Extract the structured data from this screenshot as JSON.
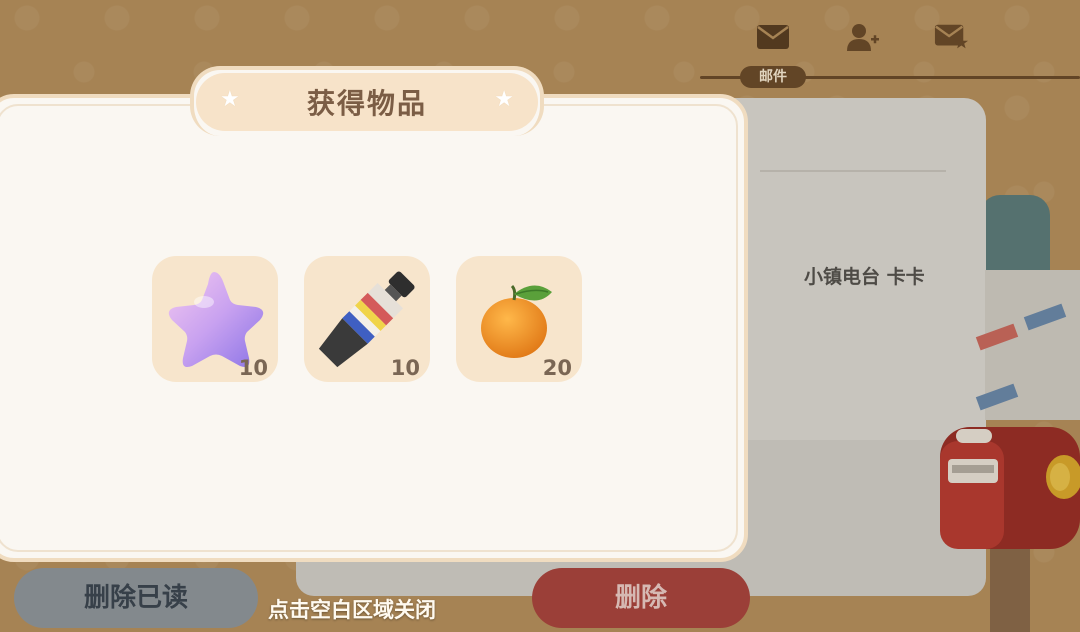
{
  "header": {
    "tab_label": "邮件",
    "icons": [
      "mail-icon",
      "add-friend-icon",
      "star-mail-icon"
    ]
  },
  "mail": {
    "sender": "小镇电台 卡卡"
  },
  "popup": {
    "title": "获得物品",
    "items": [
      {
        "icon": "purple-star-icon",
        "count": "10"
      },
      {
        "icon": "paint-tube-icon",
        "count": "10"
      },
      {
        "icon": "orange-fruit-icon",
        "count": "20"
      }
    ]
  },
  "buttons": {
    "delete_read": "删除已读",
    "delete": "删除"
  },
  "hint": "点击空白区域关闭",
  "colors": {
    "background": "#b58f5c",
    "popup_bg": "#faf7f2",
    "item_bg": "#f7e5cc",
    "delete_button": "#a9453d",
    "delete_read_button": "#8f959a",
    "title_text": "#7b5d45"
  }
}
